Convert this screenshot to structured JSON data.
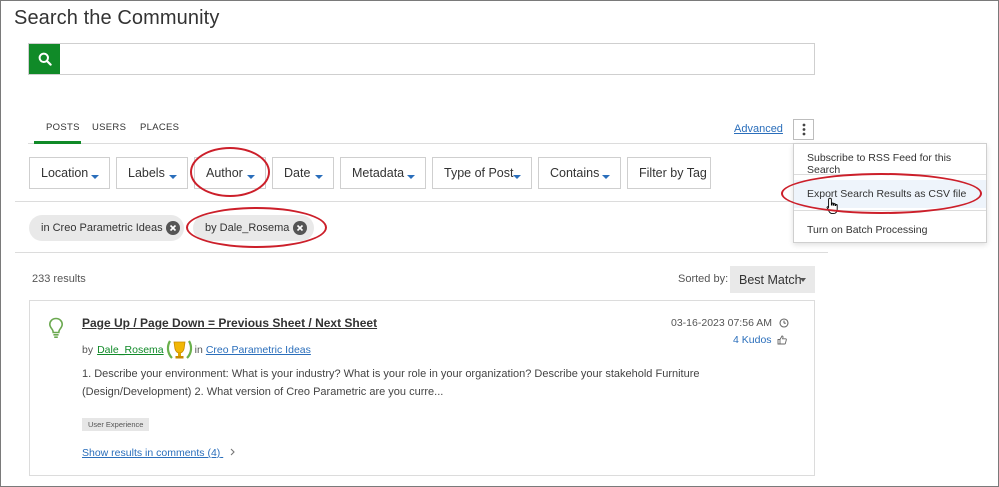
{
  "page": {
    "title": "Search the Community"
  },
  "search": {
    "placeholder": "",
    "value": ""
  },
  "tabs": [
    {
      "label": "POSTS",
      "active": true
    },
    {
      "label": "USERS",
      "active": false
    },
    {
      "label": "PLACES",
      "active": false
    }
  ],
  "advanced_label": "Advanced",
  "filters": [
    "Location",
    "Labels",
    "Author",
    "Date",
    "Metadata",
    "Type of Post",
    "Contains",
    "Filter by Tag"
  ],
  "chips": [
    "in Creo Parametric Ideas",
    "by Dale_Rosema"
  ],
  "results": {
    "count_label": "233 results",
    "sorted_by_label": "Sorted by:",
    "sort_value": "Best Match"
  },
  "result": {
    "title": "Page Up / Page Down = Previous Sheet / Next Sheet",
    "by_prefix": "by",
    "author": "Dale_Rosema",
    "in_prefix": "in",
    "place": "Creo Parametric Ideas",
    "date": "03-16-2023 07:56 AM",
    "kudos": "4 Kudos",
    "body": "1. Describe your environment: What is your industry? What is your role in your organization? Describe your stakehold Furniture (Design/Development) 2. What version of Creo Parametric are you curre...",
    "tag": "User Experience",
    "comments_link": "Show results in comments (4)"
  },
  "menu": {
    "items": [
      "Subscribe to RSS Feed for this Search",
      "Export Search Results as CSV file",
      "Turn on Batch Processing"
    ],
    "highlighted_index": 1
  },
  "colors": {
    "accent_green": "#108a28",
    "link_blue": "#2a6ebb",
    "annotation_red": "#cc1f2a"
  }
}
